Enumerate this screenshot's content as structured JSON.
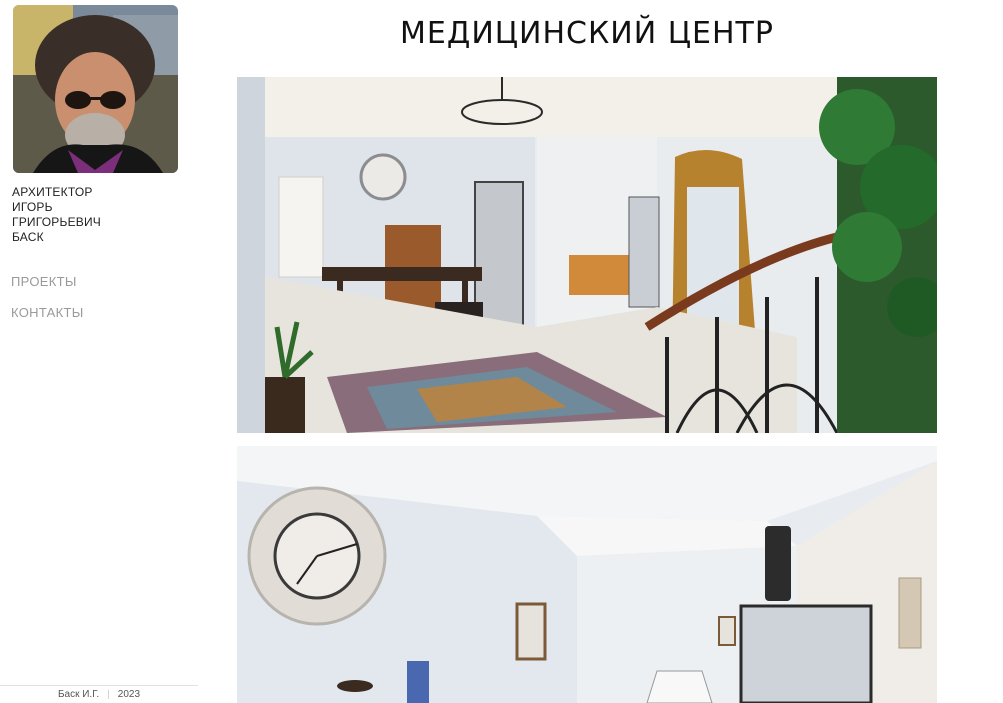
{
  "author": {
    "role": "АРХИТЕКТОР",
    "first_name": "ИГОРЬ",
    "patronymic": "ГРИГОРЬЕВИЧ",
    "last_name": "БАСК"
  },
  "nav": {
    "items": [
      {
        "label": "ПРОЕКТЫ"
      },
      {
        "label": "КОНТАКТЫ"
      }
    ]
  },
  "page": {
    "title": "МЕДИЦИНСКИЙ ЦЕНТР"
  },
  "footer": {
    "name": "Баск И.Г.",
    "separator": "|",
    "year": "2023"
  }
}
